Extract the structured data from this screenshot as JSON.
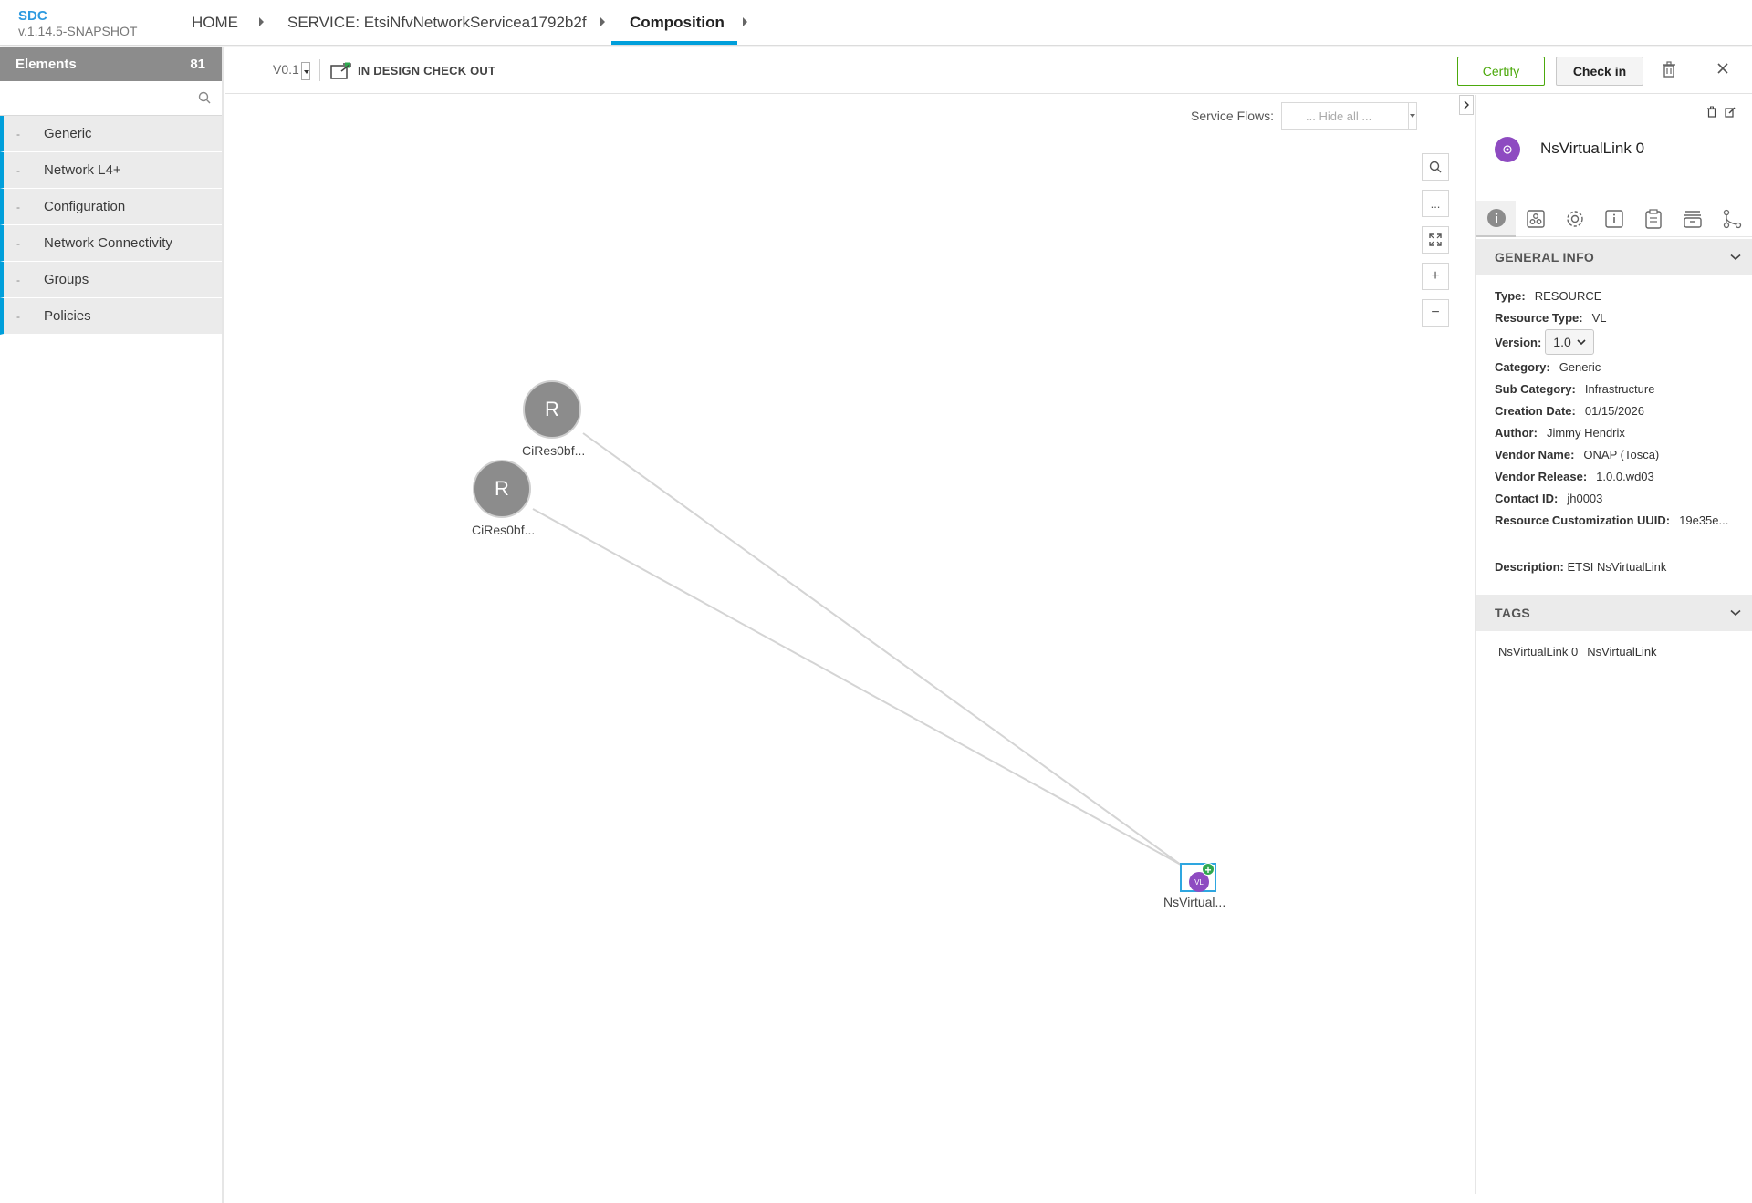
{
  "brand": {
    "name": "SDC",
    "version": "v.1.14.5-SNAPSHOT"
  },
  "breadcrumb": {
    "home": "HOME",
    "service": "SERVICE: EtsiNfvNetworkServicea1792b2f",
    "current": "Composition"
  },
  "left_panel": {
    "title": "Elements",
    "count": "81",
    "search_placeholder": "",
    "categories": [
      {
        "dash": "-",
        "label": "Generic"
      },
      {
        "dash": "-",
        "label": "Network L4+"
      },
      {
        "dash": "-",
        "label": "Configuration"
      },
      {
        "dash": "-",
        "label": "Network Connectivity"
      },
      {
        "dash": "-",
        "label": "Groups"
      },
      {
        "dash": "-",
        "label": "Policies"
      }
    ]
  },
  "toolbar": {
    "version": "V0.1",
    "status": "IN DESIGN CHECK OUT",
    "certify_label": "Certify",
    "checkin_label": "Check in"
  },
  "canvas": {
    "service_flows_label": "Service Flows:",
    "service_flows_value": "... Hide all ...",
    "nodes": [
      {
        "letter": "R",
        "label": "CiRes0bf..."
      },
      {
        "letter": "R",
        "label": "CiRes0bf..."
      },
      {
        "letter": "VL",
        "label": "NsVirtual..."
      }
    ],
    "controls": {
      "search_icon": "search-icon",
      "more": "...",
      "fit_icon": "expand-icon",
      "zoom_in": "+",
      "zoom_out": "−"
    }
  },
  "right_panel": {
    "title": "NsVirtualLink 0",
    "tabs": [
      "info-icon",
      "deployment-icon",
      "properties-icon",
      "details-icon",
      "artifacts-icon",
      "api-icon",
      "relations-icon"
    ],
    "general_info": {
      "section_title": "GENERAL INFO",
      "type_label": "Type:",
      "type": "RESOURCE",
      "resource_type_label": "Resource Type:",
      "resource_type": "VL",
      "version_label": "Version:",
      "version": "1.0",
      "category_label": "Category:",
      "category": "Generic",
      "sub_category_label": "Sub Category:",
      "sub_category": "Infrastructure",
      "creation_date_label": "Creation Date:",
      "creation_date": "01/15/2026",
      "author_label": "Author:",
      "author": "Jimmy Hendrix",
      "vendor_name_label": "Vendor Name:",
      "vendor_name": "ONAP (Tosca)",
      "vendor_release_label": "Vendor Release:",
      "vendor_release": "1.0.0.wd03",
      "contact_id_label": "Contact ID:",
      "contact_id": "jh0003",
      "uuid_label": "Resource Customization UUID:",
      "uuid": "19e35e...",
      "description_label": "Description:",
      "description": "ETSI NsVirtualLink"
    },
    "tags": {
      "section_title": "TAGS",
      "items": [
        "NsVirtualLink 0",
        "NsVirtualLink"
      ]
    }
  },
  "colors": {
    "accent": "#009fdb",
    "certify": "#4ca90c",
    "node": "#8c8c8c",
    "vl": "#8e4bc1"
  }
}
